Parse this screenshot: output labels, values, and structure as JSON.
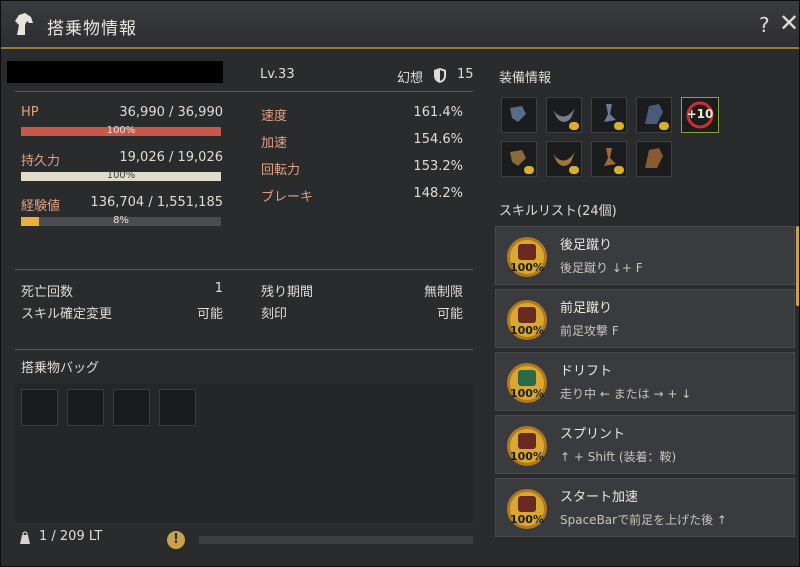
{
  "window": {
    "title": "搭乗物情報",
    "help": "?",
    "close": "✕"
  },
  "header": {
    "level": "Lv.33",
    "fantasy_label": "幻想",
    "fantasy_value": "15"
  },
  "stats": {
    "hp": {
      "label": "HP",
      "value": "36,990 / 36,990",
      "percent_text": "100%",
      "fraction": 1.0,
      "color": "#c8584c"
    },
    "stamina": {
      "label": "持久力",
      "value": "19,026 / 19,026",
      "percent_text": "100%",
      "fraction": 1.0,
      "color": "#e0dccc"
    },
    "exp": {
      "label": "経験値",
      "value": "136,704 / 1,551,185",
      "percent_text": "8%",
      "fraction": 0.088,
      "color": "#e8b040"
    }
  },
  "speed_stats": [
    {
      "label": "速度",
      "value": "161.4%"
    },
    {
      "label": "加速",
      "value": "154.6%"
    },
    {
      "label": "回転力",
      "value": "153.2%"
    },
    {
      "label": "ブレーキ",
      "value": "148.2%"
    }
  ],
  "misc": {
    "death_label": "死亡回数",
    "death_value": "1",
    "skill_change_label": "スキル確定変更",
    "skill_change_value": "可能",
    "remaining_label": "残り期間",
    "remaining_value": "無制限",
    "imprint_label": "刻印",
    "imprint_value": "可能"
  },
  "bag": {
    "title": "搭乗物バッグ",
    "weight": "1 / 209 LT",
    "warning_icon": "!"
  },
  "equipment": {
    "title": "装備情報",
    "enhance_label": "+10"
  },
  "skills": {
    "title": "スキルリスト(24個)",
    "items": [
      {
        "name": "後足蹴り",
        "command": "後足蹴り ↓+ F",
        "percent": "100%"
      },
      {
        "name": "前足蹴り",
        "command": "前足攻撃 F",
        "percent": "100%"
      },
      {
        "name": "ドリフト",
        "command": "走り中 ← または → + ↓",
        "percent": "100%"
      },
      {
        "name": "スプリント",
        "command": "↑ + Shift (装着：鞍)",
        "percent": "100%"
      },
      {
        "name": "スタート加速",
        "command": "SpaceBarで前足を上げた後 ↑",
        "percent": "100%"
      }
    ]
  }
}
